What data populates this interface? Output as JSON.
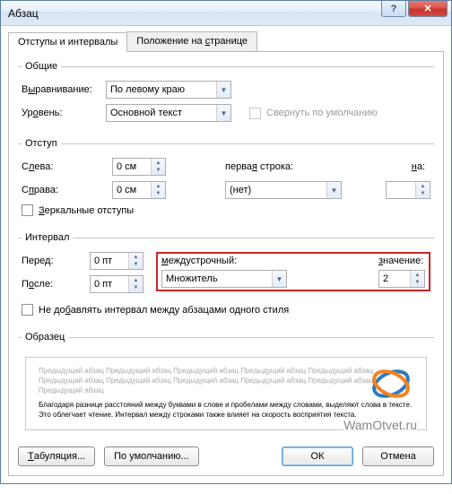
{
  "window": {
    "title": "Абзац"
  },
  "tabs": {
    "indent": "Отступы и интервалы",
    "position_pre": "Положение на ",
    "position_u": "с",
    "position_post": "транице"
  },
  "general": {
    "legend": "Общие",
    "alignment_pre": "В",
    "alignment_u": "ы",
    "alignment_post": "равнивание:",
    "alignment_val": "По левому краю",
    "level_pre": "Ур",
    "level_u": "о",
    "level_post": "вень:",
    "level_val": "Основной текст",
    "collapse": "Свернуть по умолчанию"
  },
  "indent": {
    "legend": "Отступ",
    "left_pre": "С",
    "left_u": "л",
    "left_post": "ева:",
    "left_val": "0 см",
    "right_pre": "С",
    "right_u": "п",
    "right_post": "рава:",
    "right_val": "0 см",
    "firstline_pre": "перва",
    "firstline_u": "я",
    "firstline_post": " строка:",
    "firstline_val": "(нет)",
    "by_u": "н",
    "by_post": "а:",
    "by_val": "",
    "mirror_pre": "",
    "mirror_u": "З",
    "mirror_post": "еркальные отступы"
  },
  "spacing": {
    "legend": "Интервал",
    "before_pre": "Пере",
    "before_u": "д",
    "before_post": ":",
    "before_val": "0 пт",
    "after_pre": "П",
    "after_u": "о",
    "after_post": "сле:",
    "after_val": "0 пт",
    "line_pre": "",
    "line_u": "м",
    "line_post": "еждустрочный:",
    "line_val": "Множитель",
    "at_pre": "",
    "at_u": "з",
    "at_post": "начение:",
    "at_val": "2",
    "nospace_pre": "Не до",
    "nospace_u": "б",
    "nospace_post": "авлять интервал между абзацами одного стиля"
  },
  "preview": {
    "legend": "Образец",
    "gray": "Предыдущий абзац Предыдущий абзац Предыдущий абзац Предыдущий абзац Предыдущий абзац Предыдущий абзац Предыдущий абзац Предыдущий абзац Предыдущий абзац Предыдущий абзац Предыдущий абзац",
    "main": "Благодаря разнице расстояний между буквами в слове и пробелами между словами, выделяют слова в тексте. Это облегчает чтение. Интервал между строками также влияет на скорость восприятия текста.",
    "watermark": "WamOtvet.ru"
  },
  "footer": {
    "tabs_pre": "",
    "tabs_u": "Т",
    "tabs_post": "абуляция...",
    "default": "По умолчанию...",
    "ok": "ОК",
    "cancel": "Отмена"
  }
}
